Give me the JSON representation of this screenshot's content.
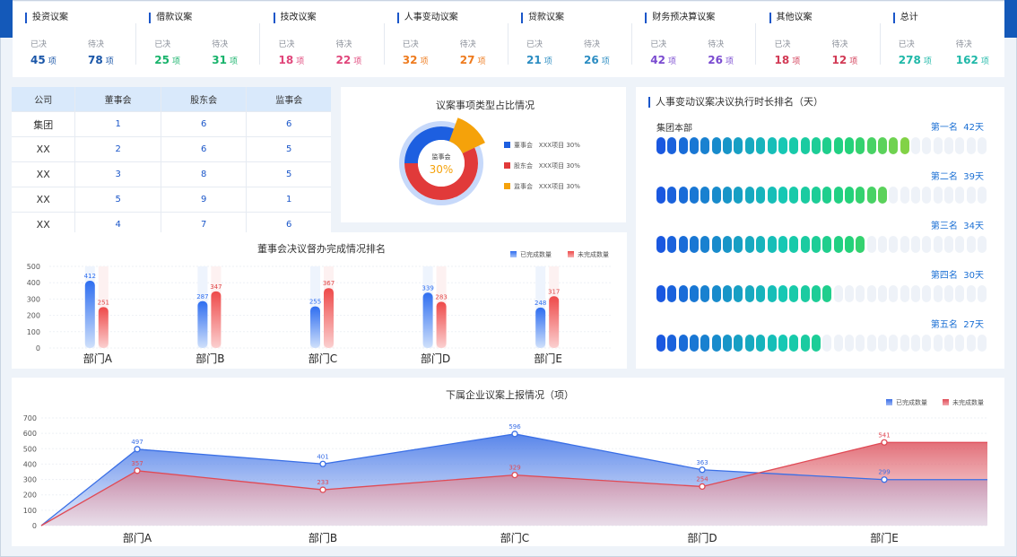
{
  "stats": [
    {
      "title": "投资议案",
      "decided_label": "已决",
      "pending_label": "待决",
      "decided": "45",
      "pending": "78",
      "unit": "项",
      "decided_color": "#1a56a8",
      "pending_color": "#1a56a8"
    },
    {
      "title": "借款议案",
      "decided_label": "已决",
      "pending_label": "待决",
      "decided": "25",
      "pending": "31",
      "unit": "项",
      "decided_color": "#18b36b",
      "pending_color": "#18b36b"
    },
    {
      "title": "技改议案",
      "decided_label": "已决",
      "pending_label": "待决",
      "decided": "18",
      "pending": "22",
      "unit": "项",
      "decided_color": "#e0457a",
      "pending_color": "#e0457a"
    },
    {
      "title": "人事变动议案",
      "decided_label": "已决",
      "pending_label": "待决",
      "decided": "32",
      "pending": "27",
      "unit": "项",
      "decided_color": "#ee7b1e",
      "pending_color": "#ee7b1e"
    },
    {
      "title": "贷款议案",
      "decided_label": "已决",
      "pending_label": "待决",
      "decided": "21",
      "pending": "26",
      "unit": "项",
      "decided_color": "#2c8dc2",
      "pending_color": "#2c8dc2"
    },
    {
      "title": "财务预决算议案",
      "decided_label": "已决",
      "pending_label": "待决",
      "decided": "42",
      "pending": "26",
      "unit": "项",
      "decided_color": "#7a4bd0",
      "pending_color": "#7a4bd0"
    },
    {
      "title": "其他议案",
      "decided_label": "已决",
      "pending_label": "待决",
      "decided": "18",
      "pending": "12",
      "unit": "项",
      "decided_color": "#d23a55",
      "pending_color": "#d23a55"
    },
    {
      "title": "总计",
      "decided_label": "已决",
      "pending_label": "待决",
      "decided": "278",
      "pending": "162",
      "unit": "项",
      "decided_color": "#1fb8a8",
      "pending_color": "#1fb8a8"
    }
  ],
  "company_table": {
    "headers": [
      "公司",
      "董事会",
      "股东会",
      "监事会"
    ],
    "rows": [
      [
        "集团",
        "1",
        "6",
        "6"
      ],
      [
        "XX",
        "2",
        "6",
        "5"
      ],
      [
        "XX",
        "3",
        "8",
        "5"
      ],
      [
        "XX",
        "5",
        "9",
        "1"
      ],
      [
        "XX",
        "4",
        "7",
        "6"
      ]
    ]
  },
  "donut": {
    "title": "议案事项类型占比情况",
    "center_label": "监事会",
    "center_value": "30%",
    "legend": [
      {
        "name": "董事会",
        "item": "XXX项目",
        "pct": "30%",
        "color": "#1d5fe0"
      },
      {
        "name": "股东会",
        "item": "XXX项目",
        "pct": "30%",
        "color": "#e13a3a"
      },
      {
        "name": "监事会",
        "item": "XXX项目",
        "pct": "30%",
        "color": "#f5a20a"
      }
    ]
  },
  "ranking": {
    "title": "人事变动议案决议执行时长排名（天）",
    "first_name": "集团本部",
    "rows": [
      {
        "rank": "第一名",
        "days": "42天",
        "value": 42
      },
      {
        "rank": "第二名",
        "days": "39天",
        "value": 39
      },
      {
        "rank": "第三名",
        "days": "34天",
        "value": 34
      },
      {
        "rank": "第四名",
        "days": "30天",
        "value": 30
      },
      {
        "rank": "第五名",
        "days": "27天",
        "value": 27
      }
    ]
  },
  "chart_data": [
    {
      "type": "bar",
      "title": "董事会决议督办完成情况排名",
      "categories": [
        "部门A",
        "部门B",
        "部门C",
        "部门D",
        "部门E"
      ],
      "series": [
        {
          "name": "已完成数量",
          "values": [
            412,
            287,
            255,
            339,
            248
          ],
          "color": "#2f6ef0"
        },
        {
          "name": "未完成数量",
          "values": [
            251,
            347,
            367,
            283,
            317
          ],
          "color": "#ee4a4a"
        }
      ],
      "ylim": [
        0,
        500
      ],
      "yticks": [
        0,
        100,
        200,
        300,
        400,
        500
      ]
    },
    {
      "type": "area",
      "title": "下属企业议案上报情况（项）",
      "categories": [
        "部门A",
        "部门B",
        "部门C",
        "部门D",
        "部门E"
      ],
      "series": [
        {
          "name": "已完成数量",
          "values": [
            497,
            401,
            596,
            363,
            299
          ],
          "color": "#3a6fe6"
        },
        {
          "name": "未完成数量",
          "values": [
            357,
            233,
            329,
            254,
            541
          ],
          "color": "#e04a55"
        }
      ],
      "ylim": [
        0,
        700
      ],
      "yticks": [
        0,
        100,
        200,
        300,
        400,
        500,
        600,
        700
      ]
    }
  ]
}
